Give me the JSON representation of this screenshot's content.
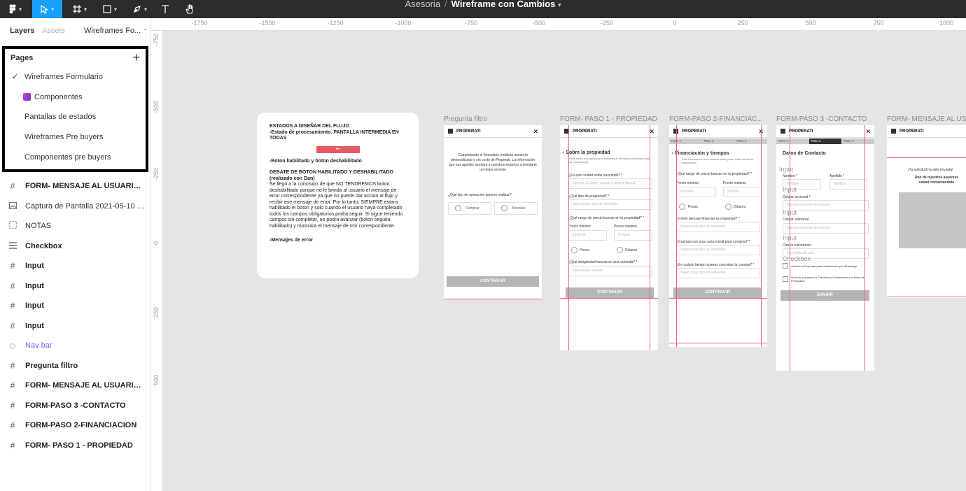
{
  "toolbar": {
    "tools": [
      "figma-menu-icon",
      "move-tool-icon",
      "frame-tool-icon",
      "shape-tool-icon",
      "pen-tool-icon",
      "text-tool-icon",
      "hand-tool-icon"
    ],
    "project": "Asesoria",
    "separator": "/",
    "file": "Wireframe con Cambios",
    "accent": "#18a0fb"
  },
  "sidebar": {
    "tab_layers": "Layers",
    "tab_assets": "Assets",
    "current_page": "Wireframes Fo...",
    "pages_title": "Pages",
    "pages": [
      "Wireframes Formulario",
      "Componentes",
      "Pantallas de estados",
      "Wireframes Pre buyers",
      "Componentes pre buyers"
    ],
    "layers": [
      {
        "icon": "#",
        "label": "FORM- MENSAJE AL USUARIO - F..."
      },
      {
        "icon": "img",
        "label": "Captura de Pantalla 2021-05-10 a ..."
      },
      {
        "icon": "dash",
        "label": "NOTAS"
      },
      {
        "icon": "lines",
        "label": "Checkbox"
      },
      {
        "icon": "#",
        "label": "Input"
      },
      {
        "icon": "#",
        "label": "Input"
      },
      {
        "icon": "#",
        "label": "Input"
      },
      {
        "icon": "#",
        "label": "Input"
      },
      {
        "icon": "diamond",
        "label": "Nav bar"
      },
      {
        "icon": "#",
        "label": "Pregunta filtro"
      },
      {
        "icon": "#",
        "label": "FORM- MENSAJE AL USUARIO - F..."
      },
      {
        "icon": "#",
        "label": "FORM-PASO 3 -CONTACTO"
      },
      {
        "icon": "#",
        "label": "FORM-PASO 2-FINANCIACION"
      },
      {
        "icon": "#",
        "label": "FORM- PASO 1 - PROPIEDAD"
      }
    ]
  },
  "rulers": {
    "top": [
      "-1750",
      "-1500",
      "-1250",
      "-1000",
      "-750",
      "-500",
      "-250",
      "0",
      "250",
      "500",
      "750",
      "1000"
    ],
    "left": [
      "-750",
      "-500",
      "-250",
      "0",
      "250",
      "500"
    ]
  },
  "canvas": {
    "notes": {
      "title": "ESTADOS A DISEÑAR DEL FLUJO",
      "line1": "-Estado de procesamiento. PANTALLA INTERMEDIA EN TODAS",
      "dots": "•••",
      "line2": "-Boton habilitado y boton deshabilitado",
      "debate_title": "DEBATE DE BOTON HABILITADO Y DESHABILITADO (realizado con Dan)",
      "debate_body": "Se llego a la concision de que NO TENDREMOS boton deshabilitado porque no le brinda al usuario el mensaje de error correspondiente ya que no puede dar accion al flujo y recibir ese mensaje de error. Por lo tanto, SIEMPRE estara habilitado el boton y solo cuando el usuario haya completado todos los campos obligatorios podra seguir. Si sigue teniendo campos sin completar, no podra avanzar (boton seguira habilitado) y mostrara el mensaje de rror correspondiente.",
      "line3": "-Mensajes de error"
    },
    "brand": "PROPERATI",
    "frames": {
      "pregunta": {
        "label": "Pregunta filtro",
        "intro": "Completando el formulario recibirás asesoría personalizada y sin costo de Properati. La información que nos aportes ayudará a nuestros expertos a brindarte un mejor servicio",
        "question": "¿Qué tipo de operación quieres realizar?",
        "opt1": "Comprar",
        "opt2": "Arrendar",
        "button": "CONTINUAR"
      },
      "paso1": {
        "label": "FORM- PASO 1 - PROPIEDAD",
        "title": "Sobre la propiedad",
        "subtitle": "Estos datos nos ayudarán a seleccionar la mejor propiedad según tus necesidades",
        "q1": "¿En qué ciudad estás buscando? *",
        "q1_ph": "Ingresa el barrio, ciudad o área a buscar",
        "q2": "¿Qué tipo de propiedad? *",
        "q2_ph": "Seleccionar tipo de inmueble",
        "q3": "¿Qué rango de precio buscas en tu propiedad? *",
        "min": "Precio mínimo",
        "max": "Precio máximo",
        "min_ph": "$ Desde",
        "max_ph": "$ Hasta",
        "cur1": "Pesos",
        "cur2": "Dólares",
        "q4": "¿Qué antigüedad buscas en una vivienda? *",
        "q4_ph": "Seleccionar estado",
        "button": "CONTINUAR"
      },
      "paso2": {
        "label": "FORM-PASO 2-FINANCIAC...",
        "steps": [
          "Paso 1",
          "Paso 2",
          "Paso 3"
        ],
        "title": "Financiación y tiempos",
        "subtitle": "Esta información nos brindará datos para poder revisar tu financiación",
        "q1": "¿Qué rango de precio buscas en tu propiedad? *",
        "min": "Precio mínimo",
        "max": "Precio máximo",
        "min_ph": "$ Desde",
        "max_ph": "$ Hasta",
        "cur1": "Pesos",
        "cur2": "Dólares",
        "q2": "¿Cómo piensas financiar tu propiedad? *",
        "q2_ph": "Seleccionar tipo de inmueble",
        "q3": "¿Cuentas con una cuota inicial para comprar? *",
        "q3_ph": "Seleccionar tipo de inmueble",
        "q4": "¿En cuánto tiempo quieres concretar la compra? *",
        "q4_ph": "Seleccionar tipo de inmueble",
        "button": "CONTINUAR"
      },
      "paso3": {
        "label": "FORM-PASO 3 -CONTACTO",
        "steps": [
          "Paso 1",
          "Paso 2",
          "Paso 3"
        ],
        "title": "Datos de Contacto",
        "input_ghost": "Input",
        "nombre": "Nombre *",
        "apellido": "Apellido *",
        "nombre_ph": "Nombre",
        "apellido_ph": "Apellido",
        "cel": "Celular personal *",
        "cel_ph": "Ingresa únicamente número",
        "cel2": "Celular adicional",
        "cel2_ph": "Ingresa únicamente número",
        "email": "Correo electrónico",
        "email_ph": "correo@mail.com",
        "checkbox_ghost": "Checkbox",
        "chk1": "Autorizo a Properati para contactarme por WhatsApp",
        "chk2": "He leído y acepto los Términos y Condiciones y el Aviso de Privacidad.",
        "button": "ENVIAR"
      },
      "mensaje": {
        "label": "FORM- MENSAJE AL USU",
        "line1": "¡Tu solicitud ha sido enviada!",
        "line2": "Uno de nuestros asesores estará contactándote"
      }
    }
  }
}
